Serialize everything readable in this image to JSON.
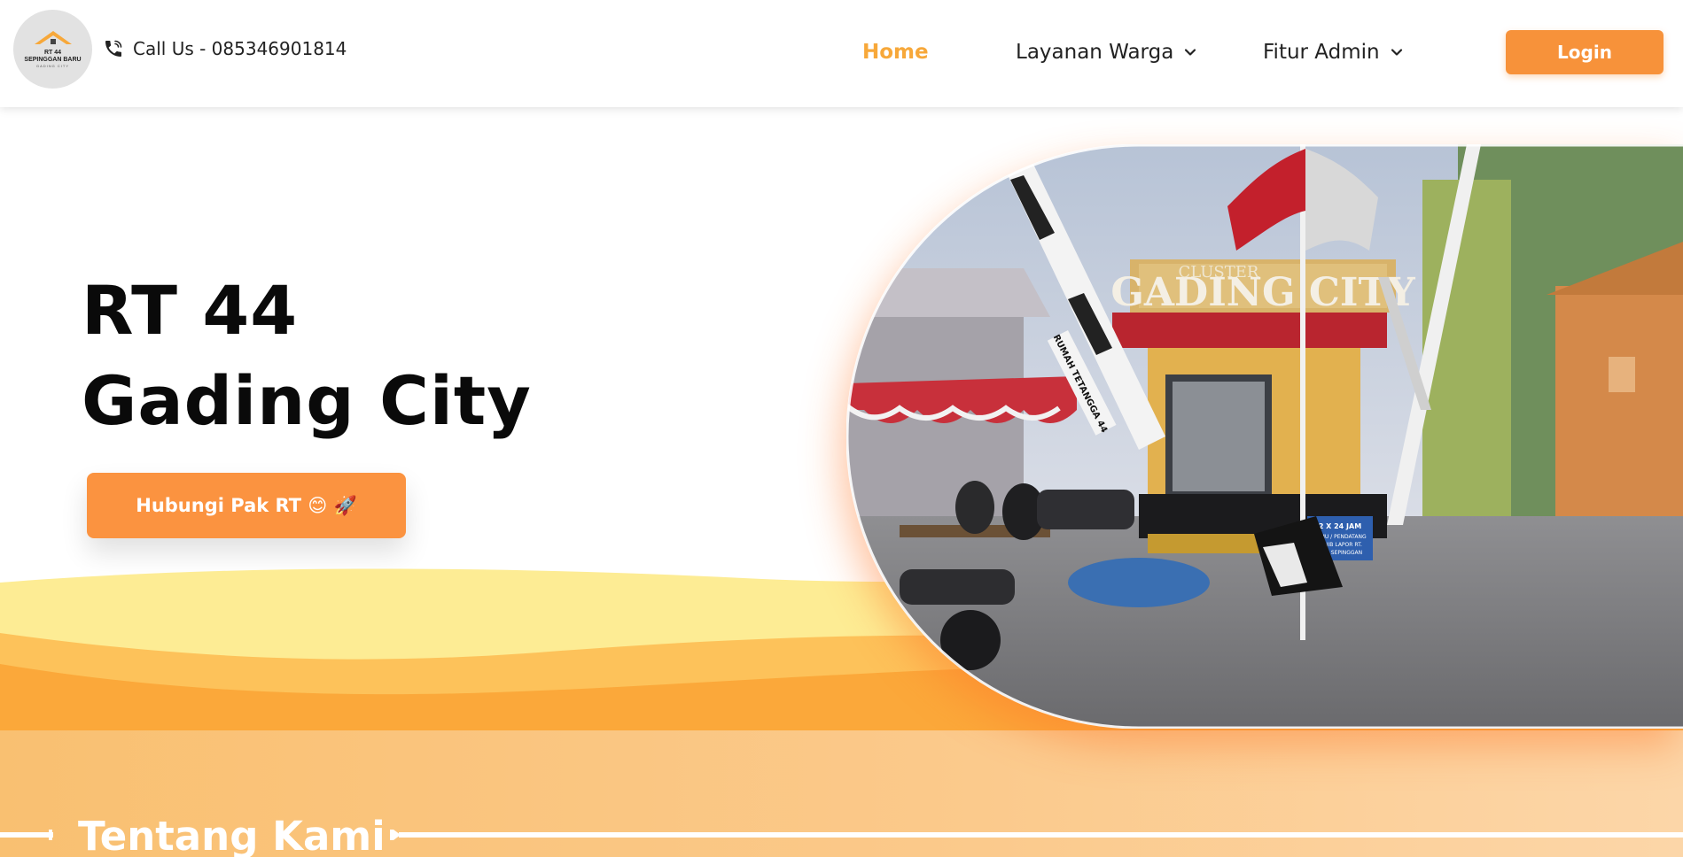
{
  "navbar": {
    "logo_text_line1": "RT 44",
    "logo_text_line2": "SEPINGGAN BARU",
    "logo_text_line3": "GADING CITY",
    "call_text": "Call Us - 085346901814",
    "links": [
      {
        "label": "Home",
        "active": true
      },
      {
        "label": "Layanan Warga",
        "dropdown": true
      },
      {
        "label": "Fitur Admin",
        "dropdown": true
      }
    ],
    "login_label": "Login"
  },
  "hero": {
    "title_line1": "RT 44",
    "title_line2": "Gading City",
    "cta_label": "Hubungi Pak RT 😊 🚀",
    "photo": {
      "sign_text": "GADING CITY",
      "sign_small": "CLUSTER",
      "banner_text": "RUMAH TETANGGA 44",
      "notice_text": "2 X 24 JAM",
      "notice_sub1": "TAMU / PENDATANG",
      "notice_sub2": "WAJIB LAPOR RT.",
      "notice_sub3": "KEL. SEPINGGAN"
    }
  },
  "about": {
    "title": "Tentang Kami"
  },
  "colors": {
    "accent": "#f7923a",
    "home_active": "#f7a83a",
    "wave_light": "#fdec94",
    "wave_mid": "#fdc25a",
    "wave_dark": "#fba83a"
  },
  "icons": {
    "phone": "phone-icon",
    "chevron": "chevron-down-icon"
  }
}
